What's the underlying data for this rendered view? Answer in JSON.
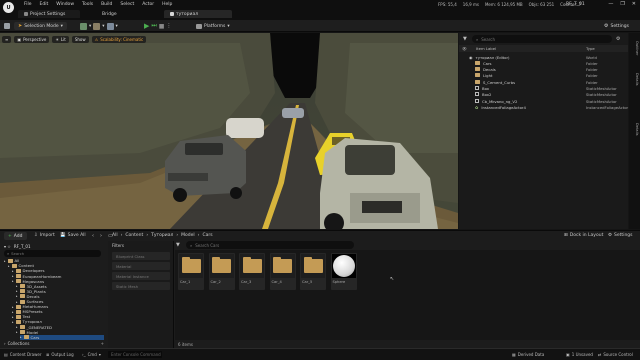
{
  "titlebar": {
    "menu": [
      "File",
      "Edit",
      "Window",
      "Tools",
      "Build",
      "Select",
      "Actor",
      "Help"
    ],
    "stats": [
      "FPS: 55,4",
      "16,9 ms",
      "Mem: 6 124,95 MB",
      "Objs: 63 251",
      "Counter: 7"
    ],
    "project_name": "RF_T_01",
    "window_buttons": [
      "—",
      "❐",
      "✕"
    ]
  },
  "tabs": {
    "project_settings": "Project Settings",
    "bridge": "Bridge",
    "level": "тутоpиал"
  },
  "toolbar": {
    "selection_mode": "Selection Mode",
    "platforms": "Platforms",
    "settings": "Settings"
  },
  "viewport": {
    "perspective": "Perspective",
    "lit": "Lit",
    "show": "Show",
    "scalability": "Scalability: Cinematic"
  },
  "outliner": {
    "search_placeholder": "Search",
    "col_label": "Item Label",
    "col_type": "Type",
    "rows": [
      {
        "label": "тутоpиал (Editor)",
        "type": "World",
        "icon": "world-icon",
        "indent": 0
      },
      {
        "label": "Cars",
        "type": "Folder",
        "icon": "folder-icon",
        "indent": 1
      },
      {
        "label": "Decals",
        "type": "Folder",
        "icon": "folder-icon",
        "indent": 1
      },
      {
        "label": "Light",
        "type": "Folder",
        "icon": "folder-icon",
        "indent": 1
      },
      {
        "label": "S_Cement_Curbs",
        "type": "Folder",
        "icon": "folder-icon",
        "indent": 1
      },
      {
        "label": "Box",
        "type": "StaticMeshActor",
        "icon": "mesh-icon",
        "indent": 1
      },
      {
        "label": "Box2",
        "type": "StaticMeshActor",
        "icon": "mesh-icon",
        "indent": 1
      },
      {
        "label": "Cb_Mkvano_ng_V2",
        "type": "StaticMeshActor",
        "icon": "mesh-icon",
        "indent": 1
      },
      {
        "label": "InstancedFoliageActor4",
        "type": "InstancedFoliageActor",
        "icon": "foliage-icon",
        "indent": 1
      }
    ],
    "side_tabs": [
      "Outliner",
      "Details",
      "Details"
    ]
  },
  "content_browser": {
    "add": "Add",
    "import": "Import",
    "save_all": "Save All",
    "breadcrumb": [
      "All",
      "Content",
      "Тутоpиал",
      "Model",
      "Cars"
    ],
    "dock_in_layout": "Dock in Layout",
    "settings": "Settings",
    "folder_search_placeholder": "Search",
    "filters_label": "Filters",
    "filter_items": [
      "Blueprint Class",
      "Material",
      "Material Instance",
      "Static Mesh"
    ],
    "asset_search_placeholder": "Search Cars",
    "item_count": "6 items",
    "tree": [
      {
        "label": "All",
        "indent": 0,
        "selected": false
      },
      {
        "label": "Content",
        "indent": 1,
        "selected": false
      },
      {
        "label": "Developers",
        "indent": 2,
        "selected": false
      },
      {
        "label": "EuropeanHornbeam",
        "indent": 2,
        "selected": false
      },
      {
        "label": "Megascans",
        "indent": 2,
        "selected": false
      },
      {
        "label": "3D_Assets",
        "indent": 3,
        "selected": false
      },
      {
        "label": "3D_Plants",
        "indent": 3,
        "selected": false
      },
      {
        "label": "Decals",
        "indent": 3,
        "selected": false
      },
      {
        "label": "Surfaces",
        "indent": 3,
        "selected": false
      },
      {
        "label": "MetaHumans",
        "indent": 2,
        "selected": false
      },
      {
        "label": "MSPresets",
        "indent": 2,
        "selected": false
      },
      {
        "label": "Test",
        "indent": 2,
        "selected": false
      },
      {
        "label": "Тутоpиал",
        "indent": 2,
        "selected": false
      },
      {
        "label": "_GENERATED",
        "indent": 3,
        "selected": false
      },
      {
        "label": "Model",
        "indent": 3,
        "selected": false
      },
      {
        "label": "Cars",
        "indent": 4,
        "selected": true
      }
    ],
    "collections": "Collections",
    "assets": [
      {
        "label": "Car_1",
        "kind": "folder"
      },
      {
        "label": "Car_2",
        "kind": "folder"
      },
      {
        "label": "Car_3",
        "kind": "folder"
      },
      {
        "label": "Car_4",
        "kind": "folder"
      },
      {
        "label": "Car_5",
        "kind": "folder"
      },
      {
        "label": "Sphere",
        "kind": "material"
      }
    ],
    "root_label": "RF_T_01"
  },
  "statusbar": {
    "content_drawer": "Content Drawer",
    "output_log": "Output Log",
    "cmd": "Cmd",
    "console_placeholder": "Enter Console Command",
    "derived_data": "Derived Data",
    "unsaved": "1 Unsaved",
    "source_control": "Source Control"
  },
  "colors": {
    "accent_green": "#4caf50",
    "folder": "#c49b55",
    "selection": "#1e4a80"
  }
}
